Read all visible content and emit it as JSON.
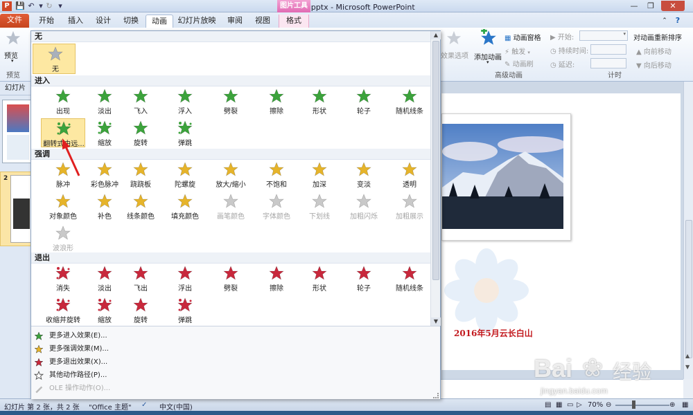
{
  "app": {
    "icon_letter": "P",
    "window_title": "电子相册.pptx - Microsoft PowerPoint",
    "context_tab_group": "图片工具"
  },
  "tabs": [
    "文件",
    "开始",
    "插入",
    "设计",
    "切换",
    "动画",
    "幻灯片放映",
    "审阅",
    "视图",
    "格式"
  ],
  "ribbon": {
    "preview_label": "预览",
    "preview_group": "预览",
    "effect_options": "效果选项",
    "add_animation": "添加动画",
    "animation_pane": "动画窗格",
    "trigger": "触发",
    "animation_painter": "动画刷",
    "advanced_group": "高级动画",
    "start_label": "开始:",
    "duration_label": "持续时间:",
    "delay_label": "延迟:",
    "reorder_title": "对动画重新排序",
    "move_earlier": "向前移动",
    "move_later": "向后移动",
    "timing_group": "计时"
  },
  "slides_panel": {
    "header": "幻灯片",
    "numbers": [
      "1",
      "2"
    ]
  },
  "gallery": {
    "sections": {
      "none": "无",
      "entrance": "进入",
      "emphasis": "强调",
      "exit": "退出"
    },
    "none_items": [
      {
        "label": "无"
      }
    ],
    "entrance_items": [
      {
        "label": "出现"
      },
      {
        "label": "淡出"
      },
      {
        "label": "飞入"
      },
      {
        "label": "浮入"
      },
      {
        "label": "劈裂"
      },
      {
        "label": "擦除"
      },
      {
        "label": "形状"
      },
      {
        "label": "轮子"
      },
      {
        "label": "随机线条"
      },
      {
        "label": "翻转式由远..."
      },
      {
        "label": "缩放"
      },
      {
        "label": "旋转"
      },
      {
        "label": "弹跳"
      }
    ],
    "emphasis_items": [
      {
        "label": "脉冲"
      },
      {
        "label": "彩色脉冲"
      },
      {
        "label": "跷跷板"
      },
      {
        "label": "陀螺旋"
      },
      {
        "label": "放大/缩小"
      },
      {
        "label": "不饱和"
      },
      {
        "label": "加深"
      },
      {
        "label": "变淡"
      },
      {
        "label": "透明"
      },
      {
        "label": "对象颜色"
      },
      {
        "label": "补色"
      },
      {
        "label": "线条颜色"
      },
      {
        "label": "填充颜色"
      },
      {
        "label": "画笔颜色"
      },
      {
        "label": "字体颜色"
      },
      {
        "label": "下划线"
      },
      {
        "label": "加粗闪烁"
      },
      {
        "label": "加粗展示"
      },
      {
        "label": "波浪形"
      }
    ],
    "exit_items": [
      {
        "label": "消失"
      },
      {
        "label": "淡出"
      },
      {
        "label": "飞出"
      },
      {
        "label": "浮出"
      },
      {
        "label": "劈裂"
      },
      {
        "label": "擦除"
      },
      {
        "label": "形状"
      },
      {
        "label": "轮子"
      },
      {
        "label": "随机线条"
      },
      {
        "label": "收缩并旋转"
      },
      {
        "label": "缩放"
      },
      {
        "label": "旋转"
      },
      {
        "label": "弹跳"
      }
    ]
  },
  "more_menu": [
    {
      "label": "更多进入效果(E)...",
      "icon": "green-star-icon"
    },
    {
      "label": "更多强调效果(M)...",
      "icon": "yellow-star-icon"
    },
    {
      "label": "更多退出效果(X)...",
      "icon": "red-star-icon"
    },
    {
      "label": "其他动作路径(P)...",
      "icon": "outline-star-icon"
    },
    {
      "label": "OLE 操作动作(O)...",
      "icon": "ole-icon"
    }
  ],
  "slide": {
    "caption": "2016年5月云长白山"
  },
  "statusbar": {
    "slide_info": "幻灯片 第 2 张，共 2 张",
    "theme": "\"Office 主题\"",
    "language": "中文(中国)",
    "zoom": "70%"
  },
  "watermark": {
    "brand": "Bai",
    "brand2": "经验",
    "url": "jingyan.baidu.com"
  },
  "colors": {
    "entrance": "#3ca33c",
    "emphasis": "#e6b42a",
    "exit": "#c8283c",
    "dim": "#c9c9c9",
    "file_tab": "#d24726"
  }
}
